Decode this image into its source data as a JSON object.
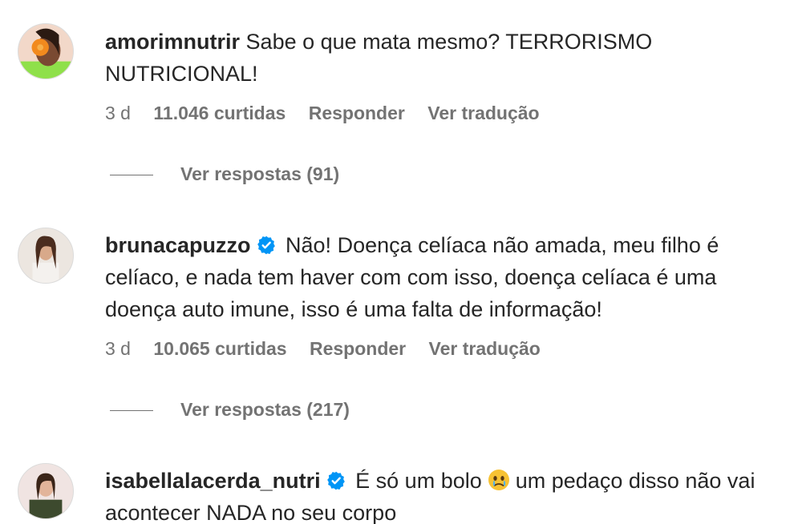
{
  "comments": [
    {
      "username": "amorimnutrir",
      "verified": false,
      "text": "Sabe o que mata mesmo? TERRORISMO NUTRICIONAL!",
      "time": "3 d",
      "likes": "11.046 curtidas",
      "reply": "Responder",
      "translate": "Ver tradução",
      "replies": "Ver respostas (91)"
    },
    {
      "username": "brunacapuzzo",
      "verified": true,
      "text": "Não! Doença celíaca não amada, meu filho é celíaco, e nada tem haver com com isso, doença celíaca é uma doença auto imune, isso é uma falta de informação!",
      "time": "3 d",
      "likes": "10.065 curtidas",
      "reply": "Responder",
      "translate": "Ver tradução",
      "replies": "Ver respostas (217)"
    },
    {
      "username": "isabellalacerda_nutri",
      "verified": true,
      "text_before_emoji": "É só um bolo",
      "emoji": "crying-face-emoji",
      "text_after_emoji": "um pedaço disso não vai acontecer NADA no seu corpo"
    }
  ]
}
